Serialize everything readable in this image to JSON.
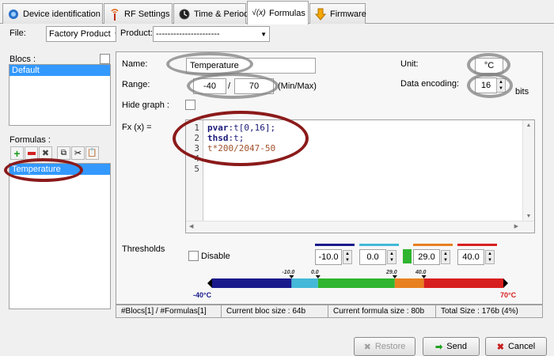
{
  "tabs": [
    {
      "label": "Device identification"
    },
    {
      "label": "RF Settings"
    },
    {
      "label": "Time & Period"
    },
    {
      "label": "Formulas"
    },
    {
      "label": "Firmware"
    }
  ],
  "header": {
    "file_label": "File:",
    "file_value": "Factory Product",
    "product_label": "Product:",
    "product_value": "----------------------"
  },
  "blocs": {
    "label": "Blocs :",
    "items": [
      "Default"
    ]
  },
  "formulas": {
    "label": "Formulas :",
    "items": [
      "Temperature"
    ]
  },
  "form": {
    "name_label": "Name:",
    "name_value": "Temperature",
    "range_label": "Range:",
    "range_min": "-40",
    "range_sep": "/",
    "range_max": "70",
    "range_unit": "(Min/Max)",
    "hide_graph_label": "Hide graph :",
    "fx_label": "Fx (x) =",
    "unit_label": "Unit:",
    "unit_value": "°C",
    "encoding_label": "Data encoding:",
    "encoding_value": "16",
    "encoding_unit": "bits"
  },
  "editor": {
    "line_numbers": [
      "1",
      "2",
      "3",
      "4",
      "5"
    ],
    "line1_kw": "pvar",
    "line1_rest": ":t[0,16];",
    "line2_kw": "thsd",
    "line2_rest": ":t;",
    "line3": "t*200/2047-50"
  },
  "thresholds": {
    "label": "Thresholds",
    "disable_label": "Disable",
    "values": [
      "-10.0",
      "0.0",
      "29.0",
      "40.0"
    ],
    "colors": [
      "#1a1a8c",
      "#44b8d8",
      "#2fb52f",
      "#e8801f",
      "#d81f1f"
    ],
    "bar_min_label": "-40°C",
    "bar_max_label": "70°C",
    "markers": [
      "-10.0",
      "0.0",
      "29.0",
      "40.0"
    ],
    "range_min": -40,
    "range_max": 70
  },
  "status": {
    "blocs_formulas": "#Blocs[1] / #Formulas[1]",
    "bloc_size": "Current bloc size : 64b",
    "formula_size": "Current formula size : 80b",
    "total_size": "Total Size : 176b (4%)"
  },
  "buttons": {
    "restore": "Restore",
    "send": "Send",
    "cancel": "Cancel"
  }
}
